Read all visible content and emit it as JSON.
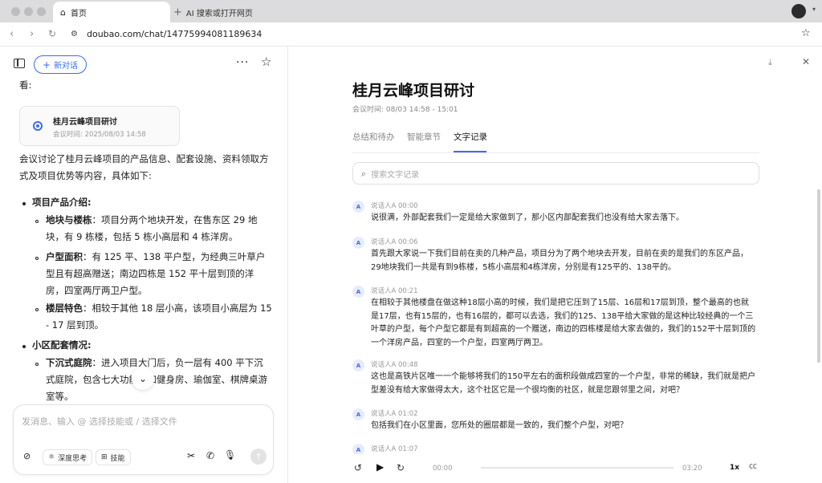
{
  "browser": {
    "tabs": [
      {
        "label": "首页"
      },
      {
        "label": "AI 搜索或打开网页"
      }
    ],
    "url": "doubao.com/chat/14775994081189634"
  },
  "left": {
    "new_chat": "新对话",
    "intro": "看:",
    "card": {
      "title": "桂月云峰项目研讨",
      "time": "会议时间: 2025/08/03 14:58"
    },
    "summary": "会议讨论了桂月云峰项目的产品信息、配套设施、资料领取方式及项目优势等内容，具体如下:",
    "sections": [
      {
        "heading": "项目产品介绍:",
        "items": [
          {
            "label": "地块与楼栋",
            "text": "：项目分两个地块开发，在售东区 29 地块，有 9 栋楼，包括 5 栋小高层和 4 栋洋房。"
          },
          {
            "label": "户型面积",
            "text": "：有 125 平、138 平户型，为经典三叶草户型且有超高赠送；南边四栋是 152 平十层到顶的洋房，四室两厅两卫户型。"
          },
          {
            "label": "楼层特色",
            "text": "：相较于其他 18 层小高，该项目小高层为 15 - 17 层到顶。"
          }
        ]
      },
      {
        "heading": "小区配套情况:",
        "items": [
          {
            "label": "下沉式庭院",
            "text": "：进入项目大门后，负一层有 400 平下沉式庭院，包含七大功能，如健身房、瑜伽室、棋牌桌游室等。"
          }
        ]
      }
    ],
    "composer": {
      "placeholder": "发消息、输入 @ 选择技能或 / 选择文件",
      "deep_think": "深度思考",
      "skills": "技能"
    }
  },
  "right": {
    "title": "桂月云峰项目研讨",
    "time": "会议时间: 08/03 14:58 - 15:01",
    "tabs": [
      "总结和待办",
      "智能章节",
      "文字记录"
    ],
    "active_tab": 2,
    "search_placeholder": "搜索文字记录",
    "segments": [
      {
        "avatar": "A",
        "speaker": "说话人A   00:00",
        "text": "说很满，外部配套我们一定是给大家做到了，那小区内部配套我们也没有给大家去落下。"
      },
      {
        "avatar": "A",
        "speaker": "说话人A   00:06",
        "text": "首先跟大家说一下我们目前在卖的几种产品，项目分为了两个地块去开发，目前在卖的是我们的东区产品，29地块我们一共是有到9栋楼，5栋小高层和4栋洋房，分别是有125平的、138平的。"
      },
      {
        "avatar": "A",
        "speaker": "说话人A   00:21",
        "text": "在相较于其他楼盘在做这种18层小高的时候，我们是把它压到了15层、16层和17层到顶，整个最高的也就是17层，也有15层的，也有16层的，都可以去选，我们的125、138平给大家做的是这种比较经典的一个三叶草的户型，每个户型它都是有到超高的一个赠送，南边的四栋楼是给大家去做的，我们的152平十层到顶的一个洋房产品，四室的一个户型，四室两厅两卫。"
      },
      {
        "avatar": "A",
        "speaker": "说话人A   00:48",
        "text": "这也是高铁片区唯一一个能够将我们的150平左右的面积段做成四室的一个户型，非常的稀缺，我们就是把户型差没有给大家做得太大，这个社区它是一个很均衡的社区，就是您跟邻里之间，对吧？"
      },
      {
        "avatar": "A",
        "speaker": "说话人A   01:02",
        "text": "包括我们在小区里面，您所处的圈层都是一致的，我们整个户型，对吧？"
      },
      {
        "avatar": "A",
        "speaker": "说话人A   01:07",
        "text": ""
      }
    ],
    "player": {
      "current": "00:00",
      "total": "03:20",
      "speed": "1x"
    }
  }
}
